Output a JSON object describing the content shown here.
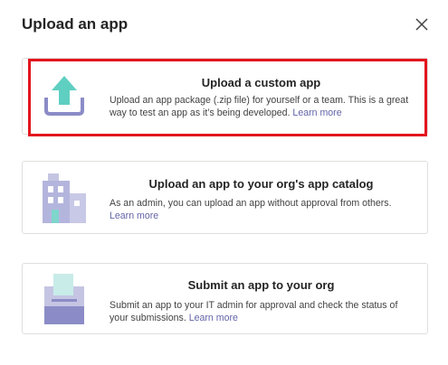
{
  "dialog": {
    "title": "Upload an app",
    "close_icon": "close-icon"
  },
  "options": [
    {
      "title": "Upload a custom app",
      "description": "Upload an app package (.zip file) for yourself or a team. This is a great way to test an app as it’s being developed.",
      "link": "Learn more",
      "icon": "upload-icon"
    },
    {
      "title": "Upload an app to your org's app catalog",
      "description": "As an admin, you can upload an app without approval from others.",
      "link": "Learn more",
      "icon": "building-icon"
    },
    {
      "title": "Submit an app to your org",
      "description": "Submit an app to your IT admin for approval and check the status of your submissions.",
      "link": "Learn more",
      "icon": "submit-tray-icon"
    }
  ],
  "colors": {
    "highlight": "#e3151e",
    "link": "#6264a7",
    "icon_teal": "#5fcfc1",
    "icon_purple": "#8b8cc7"
  }
}
